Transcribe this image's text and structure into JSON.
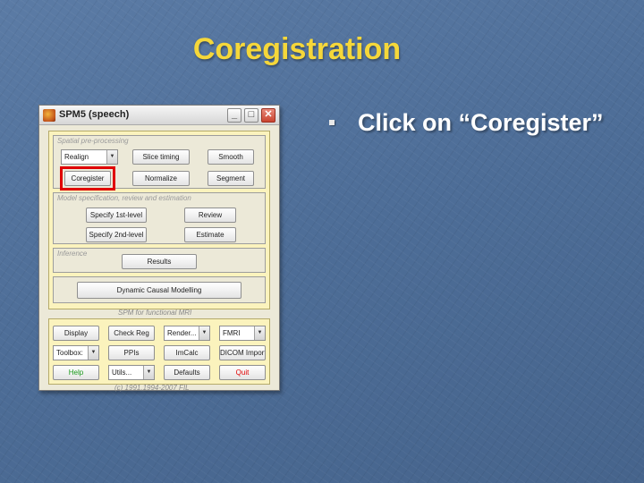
{
  "slide": {
    "title": "Coregistration",
    "bullet": "Click on “Coregister”"
  },
  "window": {
    "title": "SPM5 (speech)",
    "controls": {
      "minimize": "_",
      "maximize": "□",
      "close": "✕"
    }
  },
  "spatial": {
    "label": "Spatial pre-processing",
    "realign": "Realign",
    "slice_timing": "Slice timing",
    "smooth": "Smooth",
    "coregister": "Coregister",
    "normalize": "Normalize",
    "segment": "Segment"
  },
  "model": {
    "label": "Model specification, review and estimation",
    "specify_1st": "Specify 1st-level",
    "review": "Review",
    "specify_2nd": "Specify 2nd-level",
    "estimate": "Estimate"
  },
  "inference": {
    "label": "Inference",
    "results": "Results"
  },
  "dcm": {
    "label": "Dynamic Causal Modelling"
  },
  "footer": {
    "subtitle": "SPM for functional MRI",
    "copyright": "(c) 1991,1994-2007 FIL"
  },
  "tools": {
    "display": "Display",
    "check_reg": "Check Reg",
    "render": "Render...",
    "modality": "FMRI",
    "toolbox": "Toolbox:",
    "ppis": "PPIs",
    "imcalc": "ImCalc",
    "dicom": "DICOM Import",
    "help": "Help",
    "utils": "Utils...",
    "defaults": "Defaults",
    "quit": "Quit"
  },
  "colors": {
    "slide_bg": "#4f6f99",
    "title": "#f5d73a",
    "highlight": "#e00000",
    "panel": "#fbf3bd",
    "help_text": "#1a9a1a",
    "quit_text": "#e00000"
  },
  "icons": [
    "spm-app-icon",
    "dropdown-arrow-icon",
    "bullet-square-icon"
  ]
}
